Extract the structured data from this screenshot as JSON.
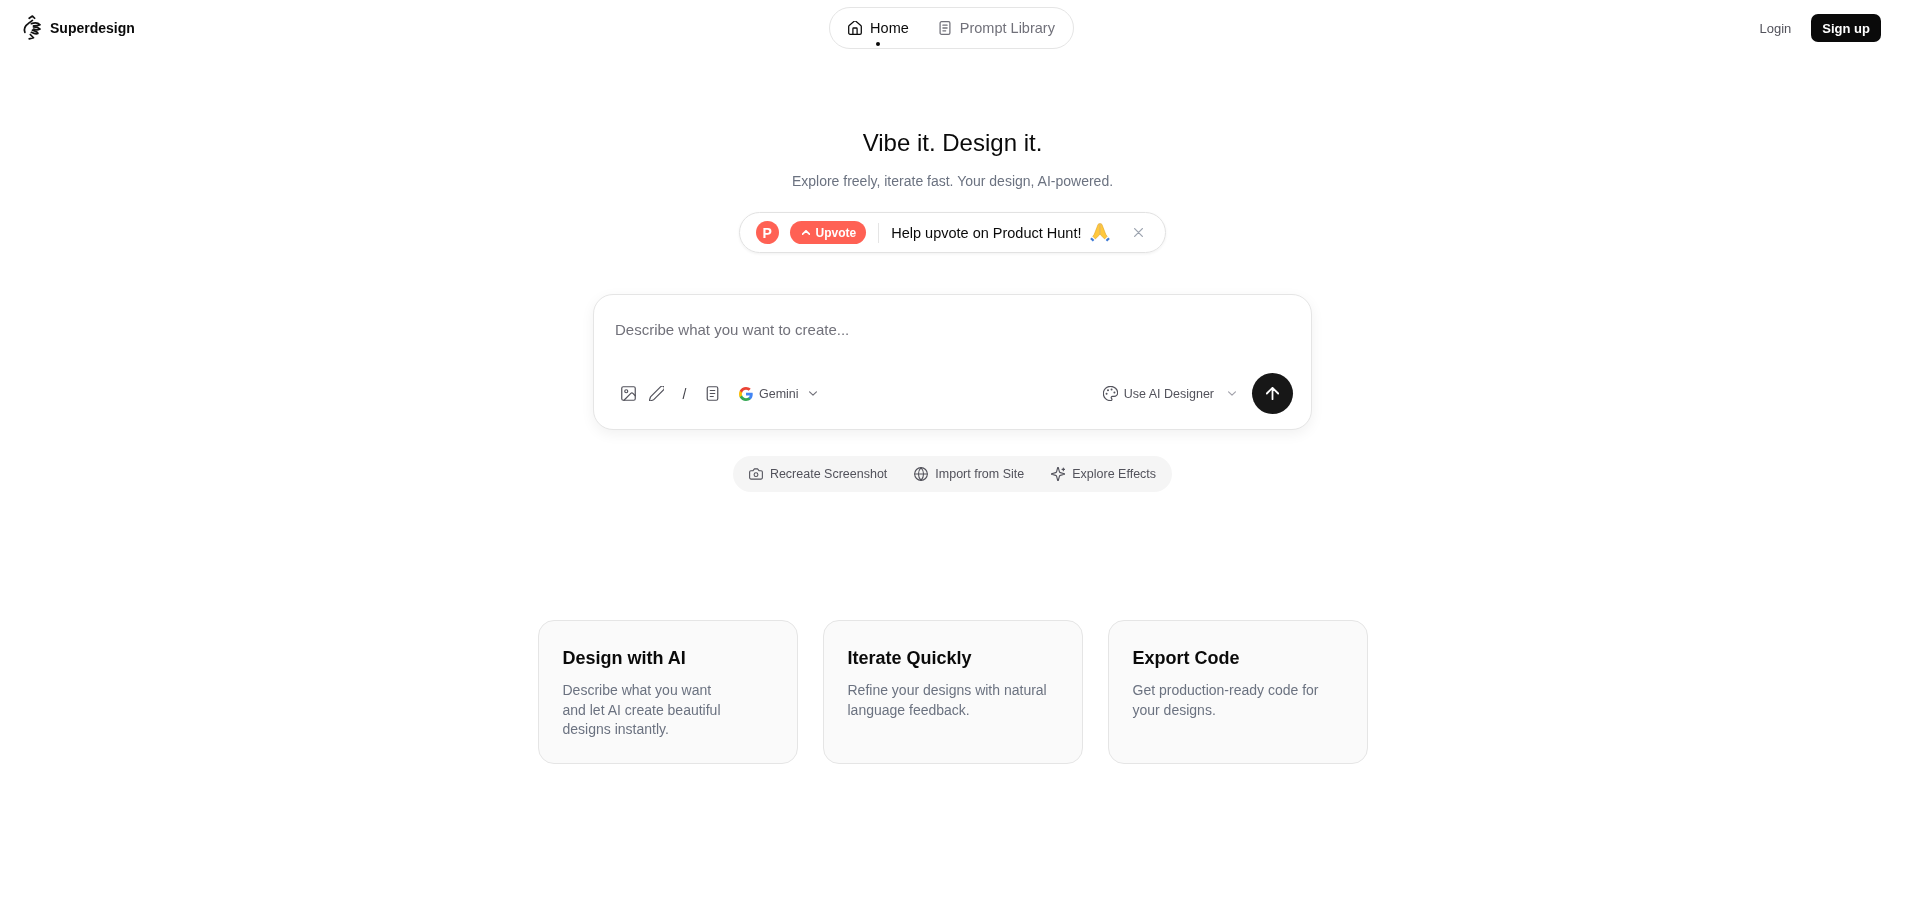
{
  "header": {
    "brand": "Superdesign",
    "nav": [
      {
        "label": "Home",
        "kind": "home",
        "selected": true
      },
      {
        "label": "Prompt Library",
        "kind": "library",
        "selected": false
      }
    ],
    "login": "Login",
    "signup": "Sign up"
  },
  "hero": {
    "title": "Vibe it. Design it.",
    "subtitle": "Explore freely, iterate fast. Your design, AI-powered."
  },
  "banner": {
    "badge": "P",
    "upvote": "Upvote",
    "message": "Help upvote on Product Hunt!"
  },
  "composer": {
    "placeholder": "Describe what you want to create...",
    "slash": "/",
    "model": "Gemini",
    "designer": "Use AI Designer"
  },
  "quick_actions": [
    {
      "label": "Recreate Screenshot",
      "kind": "screenshot"
    },
    {
      "label": "Import from Site",
      "kind": "import"
    },
    {
      "label": "Explore Effects",
      "kind": "effects"
    }
  ],
  "features": [
    {
      "title": "Design with AI",
      "text": "Describe what you want\nand let AI create beautiful designs instantly."
    },
    {
      "title": "Iterate Quickly",
      "text": "Refine your designs with natural language feedback."
    },
    {
      "title": "Export Code",
      "text": "Get production-ready code for your designs."
    }
  ]
}
